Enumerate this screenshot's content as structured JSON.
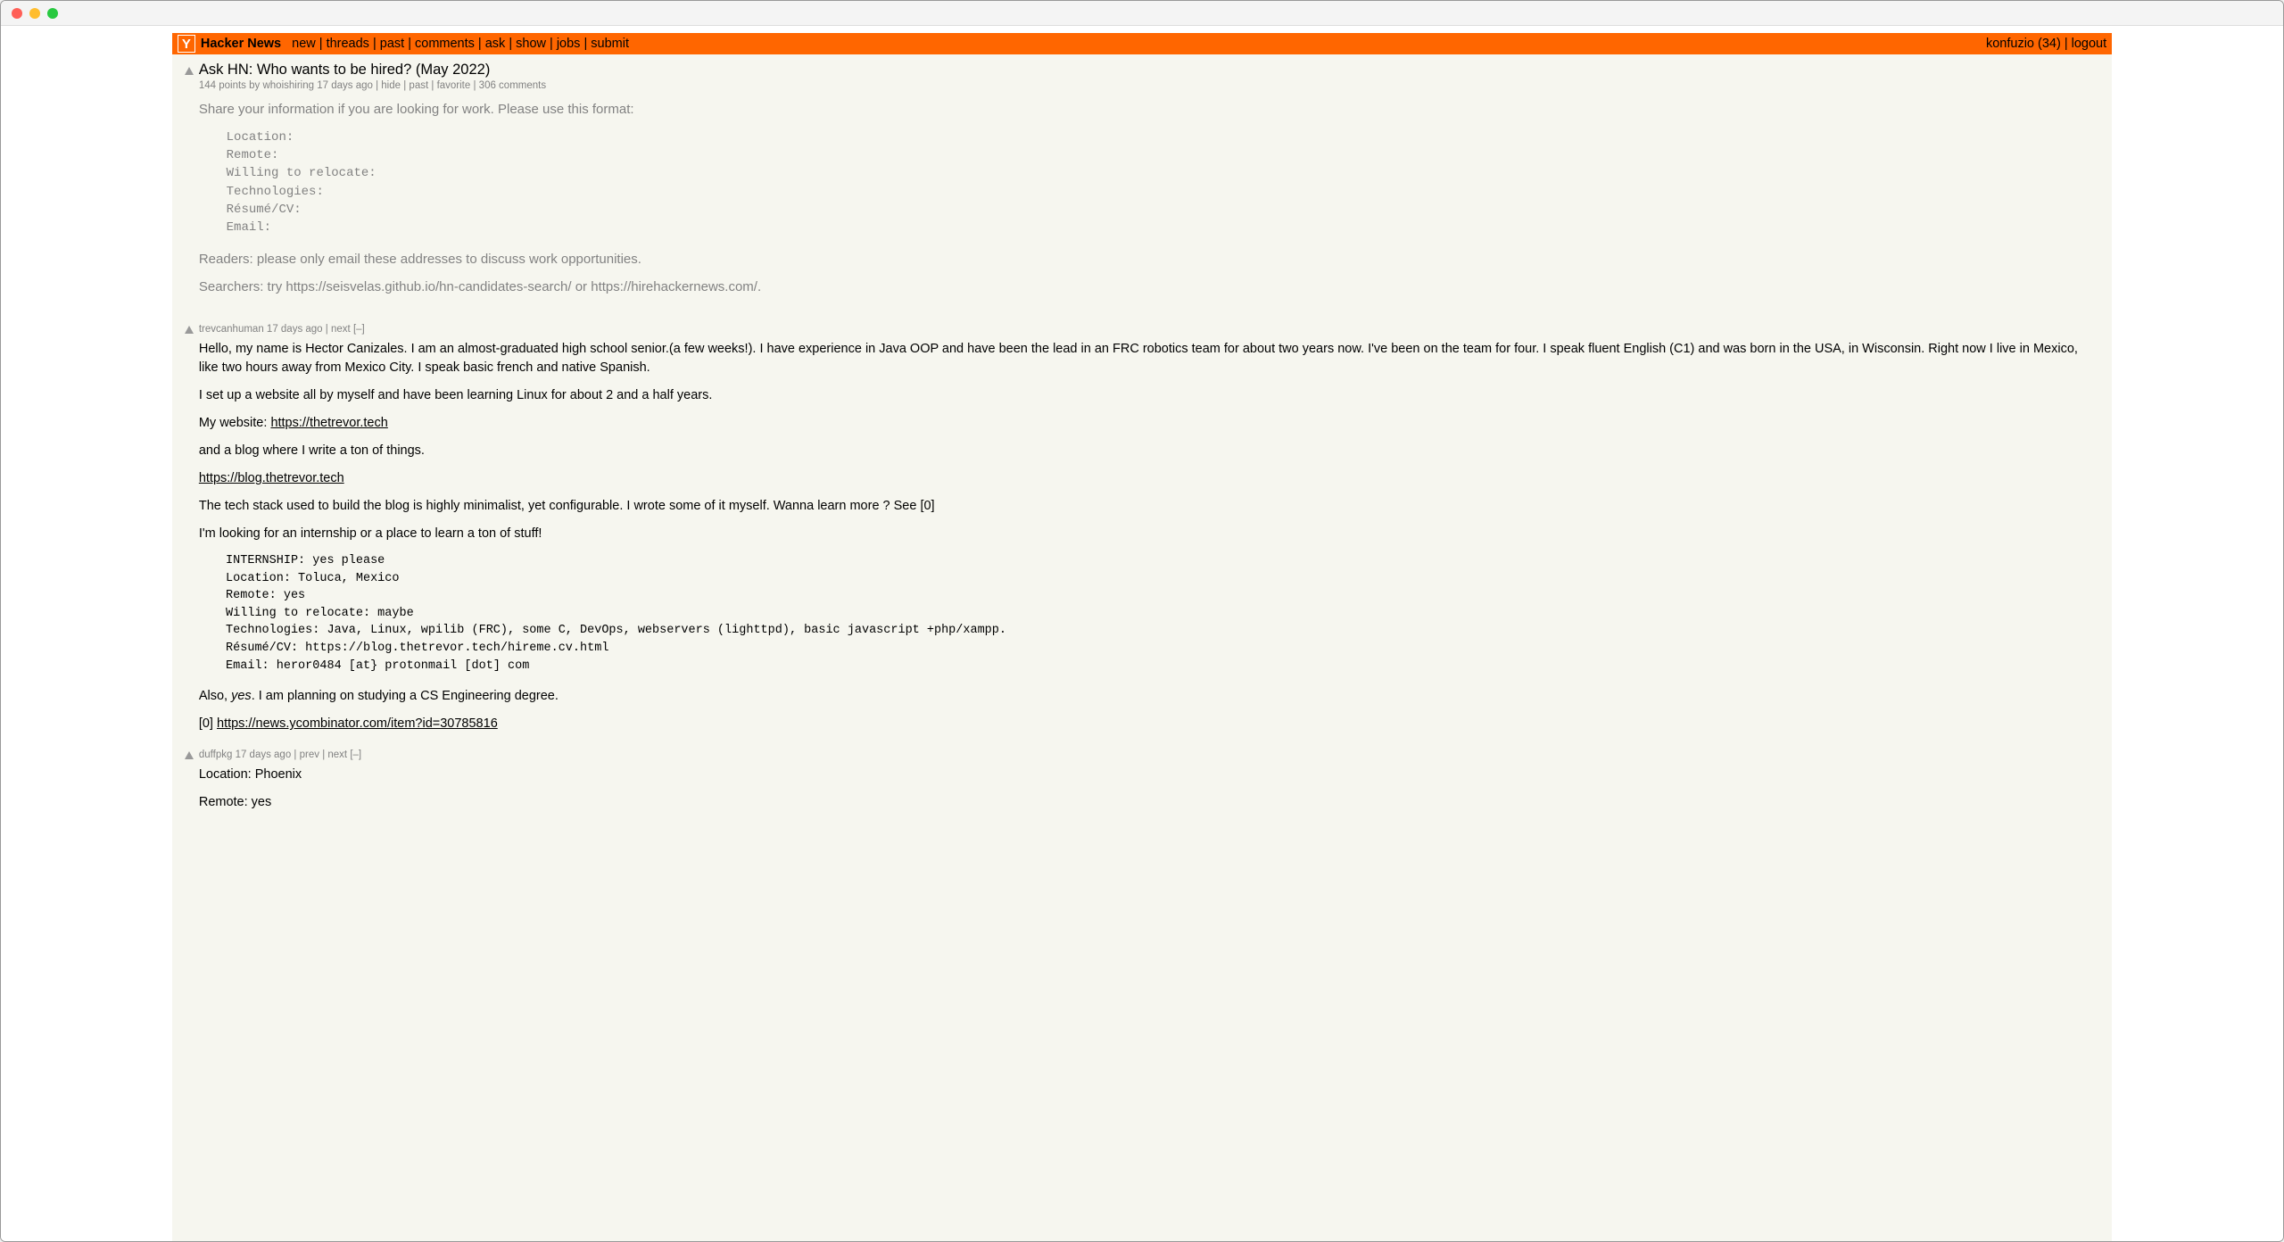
{
  "header": {
    "site_title": "Hacker News",
    "nav": {
      "new": "new",
      "threads": "threads",
      "past": "past",
      "comments": "comments",
      "ask": "ask",
      "show": "show",
      "jobs": "jobs",
      "submit": "submit"
    },
    "user": "konfuzio (34)",
    "logout": "logout"
  },
  "story": {
    "title": "Ask HN: Who wants to be hired? (May 2022)",
    "points": "144 points",
    "by_label": "by",
    "author": "whoishiring",
    "age": "17 days ago",
    "hide": "hide",
    "past": "past",
    "favorite": "favorite",
    "comment_count": "306 comments",
    "intro": "Share your information if you are looking for work. Please use this format:",
    "template": "  Location:\n  Remote:\n  Willing to relocate:\n  Technologies:\n  Résumé/CV:\n  Email:",
    "readers_note": "Readers: please only email these addresses to discuss work opportunities.",
    "searchers_note": "Searchers: try https://seisvelas.github.io/hn-candidates-search/ or https://hirehackernews.com/."
  },
  "comments": [
    {
      "author": "trevcanhuman",
      "age": "17 days ago",
      "next": "next",
      "collapse": "[–]",
      "p1": "Hello, my name is Hector Canizales. I am an almost-graduated high school senior.(a few weeks!). I have experience in Java OOP and have been the lead in an FRC robotics team for about two years now. I've been on the team for four. I speak fluent English (C1) and was born in the USA, in Wisconsin. Right now I live in Mexico, like two hours away from Mexico City. I speak basic french and native Spanish.",
      "p2": "I set up a website all by myself and have been learning Linux for about 2 and a half years.",
      "p3_prefix": "My website: ",
      "p3_link": "https://thetrevor.tech",
      "p4": "and a blog where I write a ton of things.",
      "p5_link": "https://blog.thetrevor.tech",
      "p6": "The tech stack used to build the blog is highly minimalist, yet configurable. I wrote some of it myself. Wanna learn more ? See [0]",
      "p7": "I'm looking for an internship or a place to learn a ton of stuff!",
      "pre": "  INTERNSHIP: yes please\n  Location: Toluca, Mexico\n  Remote: yes\n  Willing to relocate: maybe\n  Technologies: Java, Linux, wpilib (FRC), some C, DevOps, webservers (lighttpd), basic javascript +php/xampp.\n  Résumé/CV: https://blog.thetrevor.tech/hireme.cv.html\n  Email: heror0484 [at} protonmail [dot] com",
      "p8_prefix": "Also, ",
      "p8_em": "yes",
      "p8_suffix": ". I am planning on studying a CS Engineering degree.",
      "p9_prefix": "[0] ",
      "p9_link": "https://news.ycombinator.com/item?id=30785816"
    },
    {
      "author": "duffpkg",
      "age": "17 days ago",
      "prev": "prev",
      "next": "next",
      "collapse": "[–]",
      "p1": "Location: Phoenix",
      "p2": "Remote: yes"
    }
  ]
}
